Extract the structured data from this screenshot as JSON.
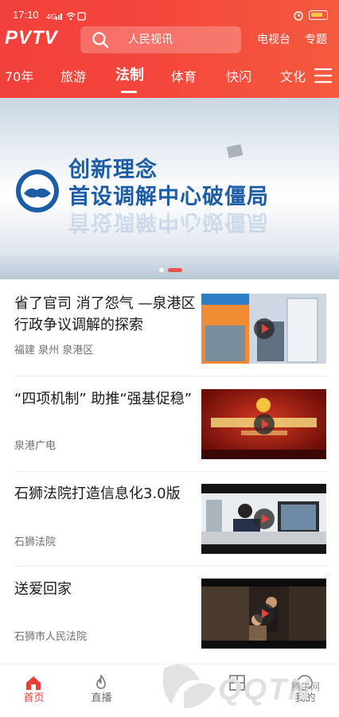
{
  "status": {
    "time": "17:10"
  },
  "topbar": {
    "logo": "PVTV",
    "search_placeholder": "人民视讯",
    "link1": "电视台",
    "link2": "专题"
  },
  "tabs": [
    "70年",
    "旅游",
    "法制",
    "体育",
    "快闪",
    "文化"
  ],
  "active_tab": "法制",
  "banner": {
    "line1": "创新理念",
    "line2": "首设调解中心破僵局",
    "slides": 2,
    "active_slide": 2
  },
  "news": [
    {
      "title": "省了官司 消了怨气 —泉港区行政争议调解的探索",
      "source": "福建 泉州 泉港区"
    },
    {
      "title": "“四项机制” 助推“强基促稳”",
      "source": "泉港广电"
    },
    {
      "title": "石狮法院打造信息化3.0版",
      "source": "石狮法院"
    },
    {
      "title": "送爱回家",
      "source": "石狮市人民法院"
    }
  ],
  "bottom_nav": [
    {
      "label": "首页",
      "icon": "home-icon",
      "active": true
    },
    {
      "label": "直播",
      "icon": "flame-icon",
      "active": false
    },
    {
      "label": "",
      "icon": "grid-icon",
      "active": false
    },
    {
      "label": "我的",
      "icon": "user-icon",
      "active": false
    }
  ],
  "watermark": {
    "brand": "QQTN",
    "site": "腾牛网"
  },
  "colors": {
    "accent": "#f2403a",
    "banner_text": "#1d5da6"
  }
}
